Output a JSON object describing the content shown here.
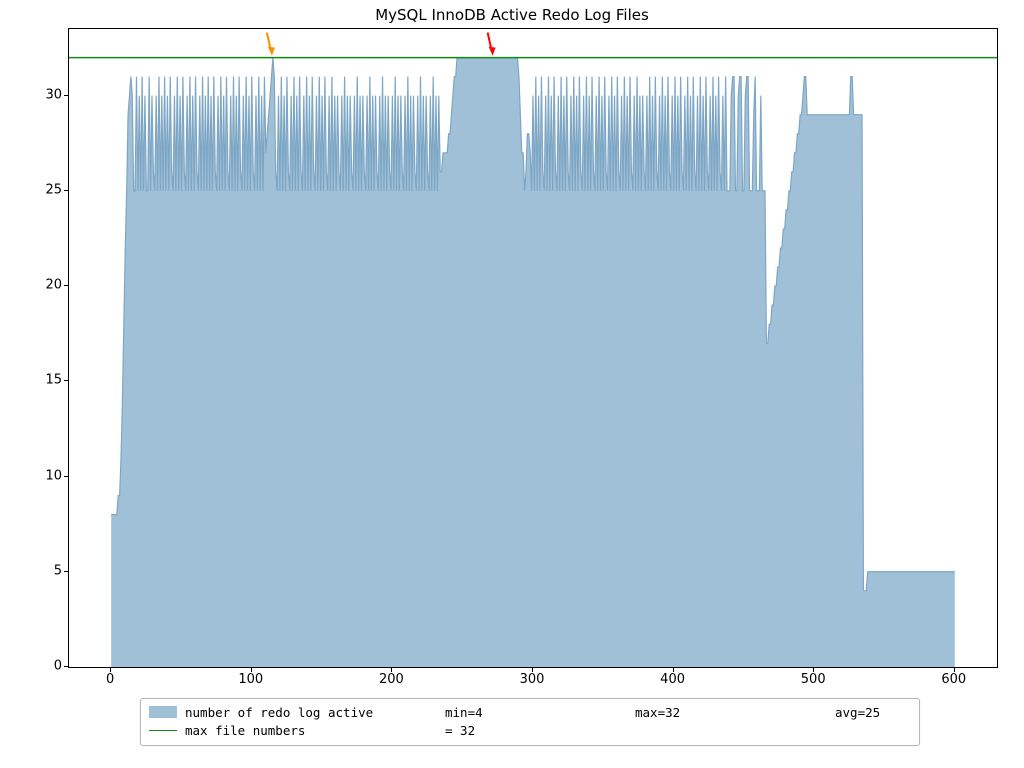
{
  "chart_data": {
    "type": "area",
    "title": "MySQL InnoDB Active Redo Log Files",
    "xlabel": "",
    "ylabel": "",
    "xlim": [
      -30,
      630
    ],
    "ylim": [
      0,
      33.5
    ],
    "x_ticks": [
      0,
      100,
      200,
      300,
      400,
      500,
      600
    ],
    "y_ticks": [
      0,
      5,
      10,
      15,
      20,
      25,
      30
    ],
    "max_line": 32,
    "annotations": [
      {
        "x": 115,
        "y": 32,
        "color": "#ff8c00"
      },
      {
        "x": 272,
        "y": 32,
        "color": "#ff0000"
      }
    ],
    "series": [
      {
        "name": "number of redo log active",
        "color_fill": "#a0c0d8",
        "color_line": "#7da6c4",
        "stats": {
          "min": 4,
          "max": 32,
          "avg": 25
        },
        "x": [
          0,
          1,
          2,
          3,
          4,
          5,
          6,
          7,
          8,
          9,
          10,
          11,
          12,
          13,
          14,
          15,
          16,
          17,
          18,
          19,
          20,
          21,
          22,
          23,
          24,
          25,
          26,
          27,
          28,
          29,
          30,
          31,
          32,
          33,
          34,
          35,
          36,
          37,
          38,
          39,
          40,
          41,
          42,
          43,
          44,
          45,
          46,
          47,
          48,
          49,
          50,
          51,
          52,
          53,
          54,
          55,
          56,
          57,
          58,
          59,
          60,
          61,
          62,
          63,
          64,
          65,
          66,
          67,
          68,
          69,
          70,
          71,
          72,
          73,
          74,
          75,
          76,
          77,
          78,
          79,
          80,
          81,
          82,
          83,
          84,
          85,
          86,
          87,
          88,
          89,
          90,
          91,
          92,
          93,
          94,
          95,
          96,
          97,
          98,
          99,
          100,
          101,
          102,
          103,
          104,
          105,
          106,
          107,
          108,
          109,
          110,
          111,
          112,
          113,
          114,
          115,
          116,
          117,
          118,
          119,
          120,
          121,
          122,
          123,
          124,
          125,
          126,
          127,
          128,
          129,
          130,
          131,
          132,
          133,
          134,
          135,
          136,
          137,
          138,
          139,
          140,
          141,
          142,
          143,
          144,
          145,
          146,
          147,
          148,
          149,
          150,
          151,
          152,
          153,
          154,
          155,
          156,
          157,
          158,
          159,
          160,
          161,
          162,
          163,
          164,
          165,
          166,
          167,
          168,
          169,
          170,
          171,
          172,
          173,
          174,
          175,
          176,
          177,
          178,
          179,
          180,
          181,
          182,
          183,
          184,
          185,
          186,
          187,
          188,
          189,
          190,
          191,
          192,
          193,
          194,
          195,
          196,
          197,
          198,
          199,
          200,
          201,
          202,
          203,
          204,
          205,
          206,
          207,
          208,
          209,
          210,
          211,
          212,
          213,
          214,
          215,
          216,
          217,
          218,
          219,
          220,
          221,
          222,
          223,
          224,
          225,
          226,
          227,
          228,
          229,
          230,
          231,
          232,
          233,
          234,
          235,
          236,
          237,
          238,
          239,
          240,
          241,
          242,
          243,
          244,
          245,
          246,
          247,
          248,
          249,
          250,
          251,
          252,
          253,
          254,
          255,
          256,
          257,
          258,
          259,
          260,
          261,
          262,
          263,
          264,
          265,
          266,
          267,
          268,
          269,
          270,
          271,
          272,
          273,
          274,
          275,
          276,
          277,
          278,
          279,
          280,
          281,
          282,
          283,
          284,
          285,
          286,
          287,
          288,
          289,
          290,
          291,
          292,
          293,
          294,
          295,
          296,
          297,
          298,
          299,
          300,
          301,
          302,
          303,
          304,
          305,
          306,
          307,
          308,
          309,
          310,
          311,
          312,
          313,
          314,
          315,
          316,
          317,
          318,
          319,
          320,
          321,
          322,
          323,
          324,
          325,
          326,
          327,
          328,
          329,
          330,
          331,
          332,
          333,
          334,
          335,
          336,
          337,
          338,
          339,
          340,
          341,
          342,
          343,
          344,
          345,
          346,
          347,
          348,
          349,
          350,
          351,
          352,
          353,
          354,
          355,
          356,
          357,
          358,
          359,
          360,
          361,
          362,
          363,
          364,
          365,
          366,
          367,
          368,
          369,
          370,
          371,
          372,
          373,
          374,
          375,
          376,
          377,
          378,
          379,
          380,
          381,
          382,
          383,
          384,
          385,
          386,
          387,
          388,
          389,
          390,
          391,
          392,
          393,
          394,
          395,
          396,
          397,
          398,
          399,
          400,
          401,
          402,
          403,
          404,
          405,
          406,
          407,
          408,
          409,
          410,
          411,
          412,
          413,
          414,
          415,
          416,
          417,
          418,
          419,
          420,
          421,
          422,
          423,
          424,
          425,
          426,
          427,
          428,
          429,
          430,
          431,
          432,
          433,
          434,
          435,
          436,
          437,
          438,
          439,
          440,
          441,
          442,
          443,
          444,
          445,
          446,
          447,
          448,
          449,
          450,
          451,
          452,
          453,
          454,
          455,
          456,
          457,
          458,
          459,
          460,
          461,
          462,
          463,
          464,
          465,
          466,
          467,
          468,
          469,
          470,
          471,
          472,
          473,
          474,
          475,
          476,
          477,
          478,
          479,
          480,
          481,
          482,
          483,
          484,
          485,
          486,
          487,
          488,
          489,
          490,
          491,
          492,
          493,
          494,
          495,
          496,
          497,
          498,
          499,
          500,
          501,
          502,
          503,
          504,
          505,
          506,
          507,
          508,
          509,
          510,
          511,
          512,
          513,
          514,
          515,
          516,
          517,
          518,
          519,
          520,
          521,
          522,
          523,
          524,
          525,
          526,
          527,
          528,
          529,
          530,
          531,
          532,
          533,
          534,
          535,
          536,
          537,
          538,
          539,
          540,
          541,
          542,
          543,
          544,
          545,
          546,
          547,
          548,
          549,
          550,
          551,
          552,
          553,
          554,
          555,
          556,
          557,
          558,
          559,
          560,
          561,
          562,
          563,
          564,
          565,
          566,
          567,
          568,
          569,
          570,
          571,
          572,
          573,
          574,
          575,
          576,
          577,
          578,
          579,
          580,
          581,
          582,
          583,
          584,
          585,
          586,
          587,
          588,
          589,
          590,
          591,
          592,
          593,
          594,
          595,
          596,
          597,
          598,
          599,
          600
        ],
        "y": [
          8,
          8,
          8,
          8,
          8,
          9,
          9,
          11,
          14,
          18,
          22,
          25,
          29,
          30,
          31,
          30,
          25,
          25,
          31,
          25,
          30,
          25,
          31,
          25,
          30,
          25,
          25,
          31,
          25,
          30,
          26,
          25,
          30,
          25,
          31,
          25,
          30,
          25,
          31,
          25,
          30,
          25,
          31,
          26,
          25,
          30,
          25,
          31,
          25,
          30,
          25,
          31,
          26,
          25,
          30,
          25,
          31,
          25,
          30,
          25,
          31,
          26,
          25,
          30,
          25,
          31,
          25,
          30,
          25,
          31,
          25,
          30,
          25,
          31,
          26,
          25,
          30,
          25,
          31,
          25,
          30,
          25,
          31,
          26,
          25,
          30,
          25,
          31,
          25,
          30,
          25,
          31,
          26,
          25,
          30,
          25,
          31,
          25,
          30,
          25,
          31,
          26,
          25,
          30,
          25,
          31,
          25,
          30,
          25,
          31,
          27,
          28,
          29,
          30,
          31,
          32,
          31,
          26,
          25,
          30,
          25,
          31,
          25,
          30,
          25,
          31,
          26,
          25,
          30,
          25,
          31,
          25,
          30,
          25,
          31,
          26,
          25,
          30,
          25,
          31,
          25,
          30,
          25,
          31,
          26,
          25,
          30,
          25,
          31,
          25,
          30,
          25,
          31,
          26,
          25,
          30,
          25,
          31,
          25,
          30,
          25,
          30,
          26,
          25,
          30,
          25,
          31,
          25,
          30,
          25,
          30,
          26,
          25,
          30,
          25,
          31,
          25,
          30,
          25,
          30,
          26,
          25,
          30,
          25,
          31,
          25,
          30,
          25,
          30,
          26,
          25,
          30,
          25,
          31,
          25,
          30,
          25,
          30,
          26,
          25,
          30,
          25,
          31,
          25,
          30,
          25,
          30,
          26,
          25,
          30,
          25,
          31,
          25,
          30,
          25,
          30,
          26,
          25,
          30,
          25,
          31,
          25,
          30,
          25,
          30,
          26,
          25,
          30,
          25,
          31,
          25,
          30,
          25,
          30,
          26,
          26,
          27,
          27,
          27,
          27,
          28,
          28,
          29,
          30,
          31,
          31,
          32,
          32,
          32,
          32,
          32,
          32,
          32,
          32,
          32,
          32,
          32,
          32,
          32,
          32,
          32,
          32,
          32,
          32,
          32,
          32,
          32,
          32,
          32,
          32,
          32,
          32,
          32,
          32,
          32,
          32,
          32,
          32,
          32,
          32,
          32,
          32,
          32,
          32,
          32,
          32,
          32,
          32,
          32,
          32,
          31,
          29,
          27,
          27,
          25,
          26,
          28,
          28,
          27,
          25,
          30,
          25,
          31,
          25,
          30,
          25,
          31,
          26,
          25,
          30,
          25,
          31,
          25,
          30,
          25,
          31,
          26,
          25,
          30,
          25,
          31,
          25,
          30,
          25,
          31,
          26,
          25,
          30,
          25,
          31,
          25,
          30,
          25,
          31,
          26,
          25,
          30,
          25,
          31,
          25,
          30,
          25,
          31,
          26,
          25,
          30,
          25,
          31,
          25,
          30,
          25,
          31,
          26,
          25,
          30,
          25,
          31,
          25,
          30,
          25,
          31,
          26,
          25,
          30,
          25,
          31,
          25,
          30,
          25,
          31,
          26,
          25,
          30,
          25,
          31,
          25,
          30,
          25,
          30,
          26,
          25,
          30,
          25,
          31,
          25,
          30,
          25,
          31,
          26,
          25,
          30,
          25,
          31,
          25,
          30,
          25,
          31,
          26,
          25,
          30,
          25,
          31,
          25,
          30,
          25,
          31,
          26,
          25,
          30,
          25,
          31,
          25,
          30,
          25,
          31,
          26,
          25,
          30,
          25,
          31,
          25,
          30,
          25,
          31,
          26,
          25,
          30,
          25,
          31,
          25,
          30,
          25,
          31,
          26,
          25,
          30,
          25,
          31,
          25,
          25,
          25,
          30,
          31,
          31,
          25,
          25,
          30,
          31,
          31,
          25,
          25,
          30,
          31,
          31,
          25,
          25,
          25,
          29,
          31,
          25,
          25,
          25,
          30,
          25,
          25,
          25,
          17,
          17,
          18,
          18,
          19,
          19,
          20,
          20,
          21,
          21,
          22,
          22,
          23,
          23,
          24,
          24,
          25,
          25,
          26,
          26,
          27,
          27,
          28,
          28,
          29,
          29,
          30,
          31,
          31,
          29,
          29,
          29,
          29,
          29,
          29,
          29,
          29,
          29,
          29,
          29,
          29,
          29,
          29,
          29,
          29,
          29,
          29,
          29,
          29,
          29,
          29,
          29,
          29,
          29,
          29,
          29,
          29,
          29,
          29,
          29,
          31,
          31,
          29,
          29,
          29,
          29,
          29,
          29,
          29,
          4,
          4,
          4,
          5,
          5,
          5,
          5,
          5,
          5,
          5,
          5,
          5,
          5,
          5,
          5,
          5,
          5,
          5,
          5,
          5,
          5,
          5,
          5,
          5,
          5,
          5,
          5,
          5,
          5,
          5,
          5,
          5,
          5,
          5,
          5,
          5,
          5,
          5,
          5,
          5,
          5,
          5,
          5,
          5,
          5,
          5,
          5,
          5,
          5,
          5,
          5,
          5,
          5,
          5,
          5,
          5,
          5,
          5,
          5,
          5,
          5,
          5,
          5,
          5,
          5,
          5
        ]
      }
    ]
  },
  "legend": {
    "series_label": "number of redo log active",
    "min_text": "min=4",
    "max_text": "max=32",
    "avg_text": "avg=25",
    "maxline_label": "max file numbers",
    "maxline_value": "= 32"
  }
}
